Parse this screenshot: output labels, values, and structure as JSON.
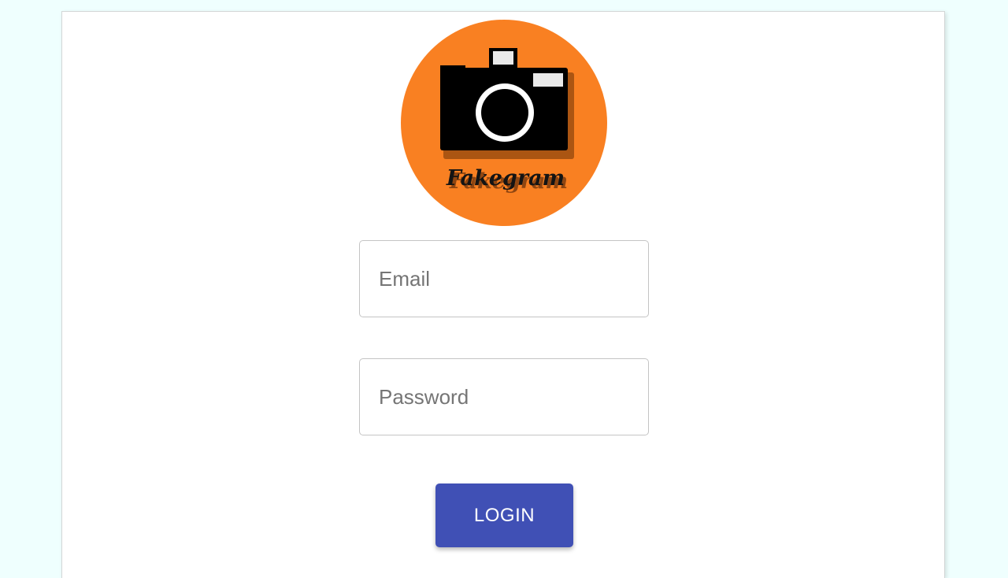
{
  "brand": {
    "logo_text": "Fakegram",
    "logo_color": "#f98022",
    "logo_icon": "camera-icon"
  },
  "form": {
    "email": {
      "value": "",
      "placeholder": "Email"
    },
    "password": {
      "value": "",
      "placeholder": "Password"
    },
    "login_label": "LOGIN",
    "button_color": "#4050b5"
  },
  "colors": {
    "page_background": "#effffe",
    "card_background": "#ffffff"
  }
}
